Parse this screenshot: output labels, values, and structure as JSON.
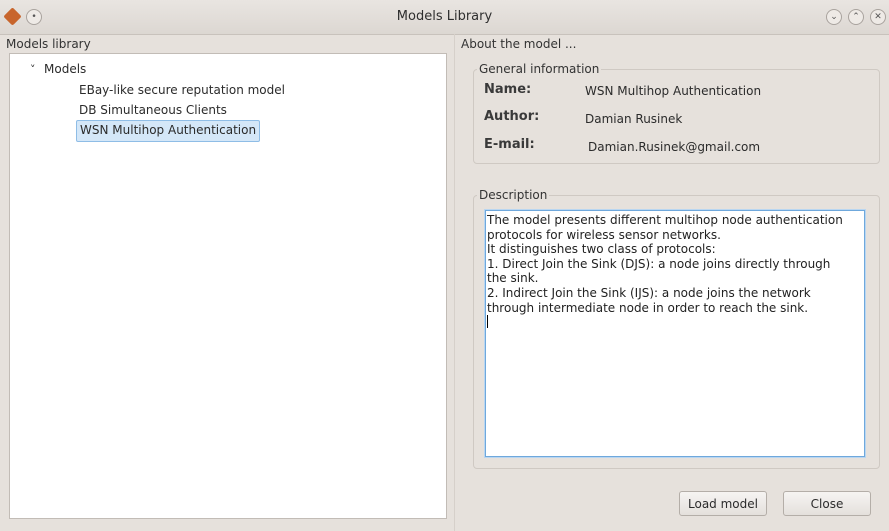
{
  "window": {
    "title": "Models Library",
    "icons": [
      "app-icon",
      "menu-icon",
      "minimize-icon",
      "maximize-icon",
      "close-icon"
    ]
  },
  "library": {
    "group_title": "Models library",
    "root_label": "Models",
    "items": [
      {
        "label": "EBay-like secure reputation model",
        "selected": false
      },
      {
        "label": "DB Simultaneous Clients",
        "selected": false
      },
      {
        "label": "WSN Multihop Authentication",
        "selected": true
      }
    ]
  },
  "about": {
    "group_title": "About the model ...",
    "general": {
      "title": "General information",
      "name_label": "Name:",
      "name_value": "WSN Multihop Authentication",
      "author_label": "Author:",
      "author_value": "Damian Rusinek",
      "email_label": "E-mail:",
      "email_value": "Damian.Rusinek@gmail.com"
    },
    "description": {
      "title": "Description",
      "lines": [
        "The model presents different multihop node authentication",
        "protocols for wireless sensor networks.",
        "It distinguishes two class of protocols:",
        "1. Direct Join the Sink (DJS): a node joins directly through",
        "the sink.",
        "2. Indirect Join the Sink (IJS): a node joins the network",
        "through intermediate node in order to reach the sink."
      ]
    }
  },
  "buttons": {
    "load_label": "Load model",
    "close_label": "Close"
  },
  "colors": {
    "selection_bg": "#d4e7f8",
    "focus_border": "#6fa8dc",
    "window_bg": "#e6e1dc"
  }
}
